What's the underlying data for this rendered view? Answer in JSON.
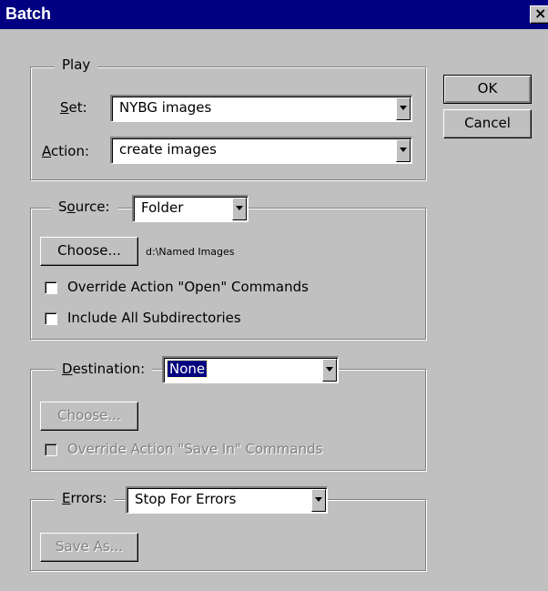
{
  "window": {
    "title": "Batch",
    "close_glyph": "×"
  },
  "play": {
    "legend": "Play",
    "set_label_prefix": "",
    "set_label_u": "S",
    "set_label_rest": "et:",
    "set_value": "NYBG images",
    "action_label_u": "A",
    "action_label_rest": "ction:",
    "action_value": "create images"
  },
  "source": {
    "label_pre": "S",
    "label_u": "o",
    "label_rest": "urce:",
    "value": "Folder",
    "choose_label": "Choose...",
    "path": "d:\\Named Images",
    "override_open": "Override Action \"Open\" Commands",
    "include_subdirs": "Include All Subdirectories"
  },
  "destination": {
    "label_u": "D",
    "label_rest": "estination:",
    "value": "None",
    "choose_label": "Choose...",
    "override_save": "Override Action \"Save In\" Commands"
  },
  "errors": {
    "label_u": "E",
    "label_rest": "rrors:",
    "value": "Stop For Errors",
    "save_as_label": "Save As..."
  },
  "buttons": {
    "ok": "OK",
    "cancel": "Cancel"
  },
  "colors": {
    "titlebar": "#000080",
    "face": "#c0c0c0",
    "selection": "#000080"
  }
}
